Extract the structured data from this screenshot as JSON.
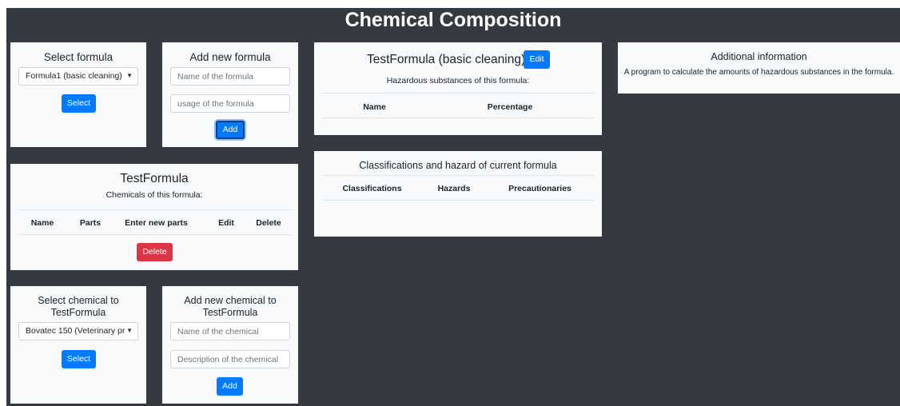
{
  "app_title": "Chemical Composition",
  "select_formula": {
    "heading": "Select formula",
    "selected": "Formula1 (basic cleaning)",
    "button": "Select"
  },
  "add_formula": {
    "heading": "Add new formula",
    "name_placeholder": "Name of the formula",
    "usage_placeholder": "usage of the formula",
    "button": "Add"
  },
  "formula_details": {
    "heading": "TestFormula (basic cleaning)",
    "edit_button": "Edit",
    "subtitle": "Hazardous substances of this formula:",
    "columns": [
      "Name",
      "Percentage"
    ]
  },
  "additional_info": {
    "heading": "Additional information",
    "text": "A program to calculate the amounts of hazardous substances in the formula."
  },
  "formula_chemicals": {
    "heading": "TestFormula",
    "subtitle": "Chemicals of this formula:",
    "columns": [
      "Name",
      "Parts",
      "Enter new parts",
      "Edit",
      "Delete"
    ],
    "delete_button": "Delete"
  },
  "classifications": {
    "heading": "Classifications and hazard of current formula",
    "columns": [
      "Classifications",
      "Hazards",
      "Precautionaries"
    ]
  },
  "select_chemical": {
    "heading_line1": "Select chemical to",
    "heading_line2": "TestFormula",
    "selected": "Bovatec 150 (Veterinary pr",
    "button": "Select"
  },
  "add_chemical": {
    "heading_line1": "Add new chemical to",
    "heading_line2": "TestFormula",
    "name_placeholder": "Name of the chemical",
    "description_placeholder": "Description of the chemical",
    "button": "Add"
  },
  "icons": {
    "dropdown": "caret-down-icon"
  },
  "colors": {
    "background": "#343a40",
    "card": "#f8f9fa",
    "primary": "#007bff",
    "danger": "#dc3545"
  }
}
